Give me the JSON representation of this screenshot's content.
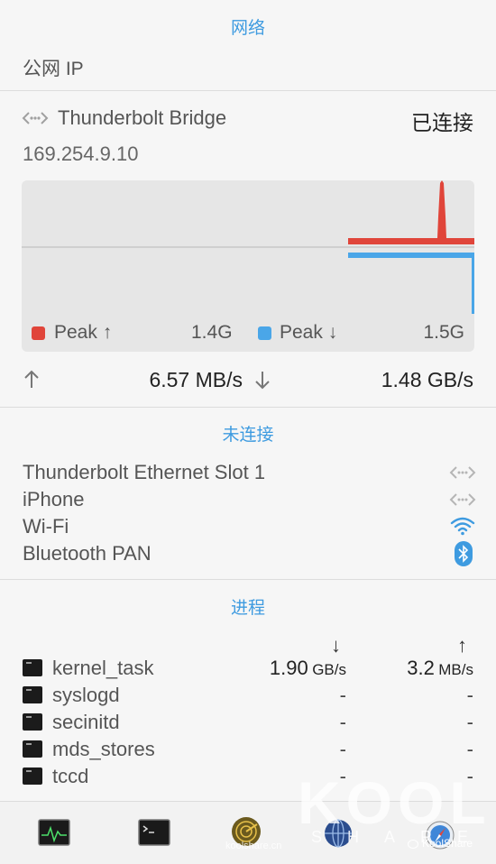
{
  "network": {
    "title": "网络",
    "public_ip_label": "公网 IP"
  },
  "bridge": {
    "name": "Thunderbolt Bridge",
    "status": "已连接",
    "ip": "169.254.9.10",
    "legend_up_label": "Peak ↑",
    "legend_up_value": "1.4G",
    "legend_down_label": "Peak ↓",
    "legend_down_value": "1.5G",
    "upload_speed": "6.57 MB/s",
    "download_speed": "1.48 GB/s",
    "colors": {
      "up": "#e0453a",
      "down": "#4aa6e8"
    }
  },
  "disconnected": {
    "title": "未连接",
    "items": [
      {
        "label": "Thunderbolt Ethernet Slot 1",
        "icon": "ethernet-icon"
      },
      {
        "label": "iPhone",
        "icon": "ethernet-icon"
      },
      {
        "label": "Wi-Fi",
        "icon": "wifi-icon"
      },
      {
        "label": "Bluetooth PAN",
        "icon": "bluetooth-icon"
      }
    ]
  },
  "processes": {
    "title": "进程",
    "down_header": "↓",
    "up_header": "↑",
    "rows": [
      {
        "name": "kernel_task",
        "down_num": "1.90",
        "down_unit": "GB/s",
        "up_num": "3.2",
        "up_unit": "MB/s"
      },
      {
        "name": "syslogd",
        "down_num": "-",
        "down_unit": "",
        "up_num": "-",
        "up_unit": ""
      },
      {
        "name": "secinitd",
        "down_num": "-",
        "down_unit": "",
        "up_num": "-",
        "up_unit": ""
      },
      {
        "name": "mds_stores",
        "down_num": "-",
        "down_unit": "",
        "up_num": "-",
        "up_unit": ""
      },
      {
        "name": "tccd",
        "down_num": "-",
        "down_unit": "",
        "up_num": "-",
        "up_unit": ""
      }
    ]
  },
  "watermark": {
    "brand_big": "KOOL",
    "brand_small": "SHARE",
    "wechat": "KoolShare",
    "site": "koolshare.cn"
  }
}
